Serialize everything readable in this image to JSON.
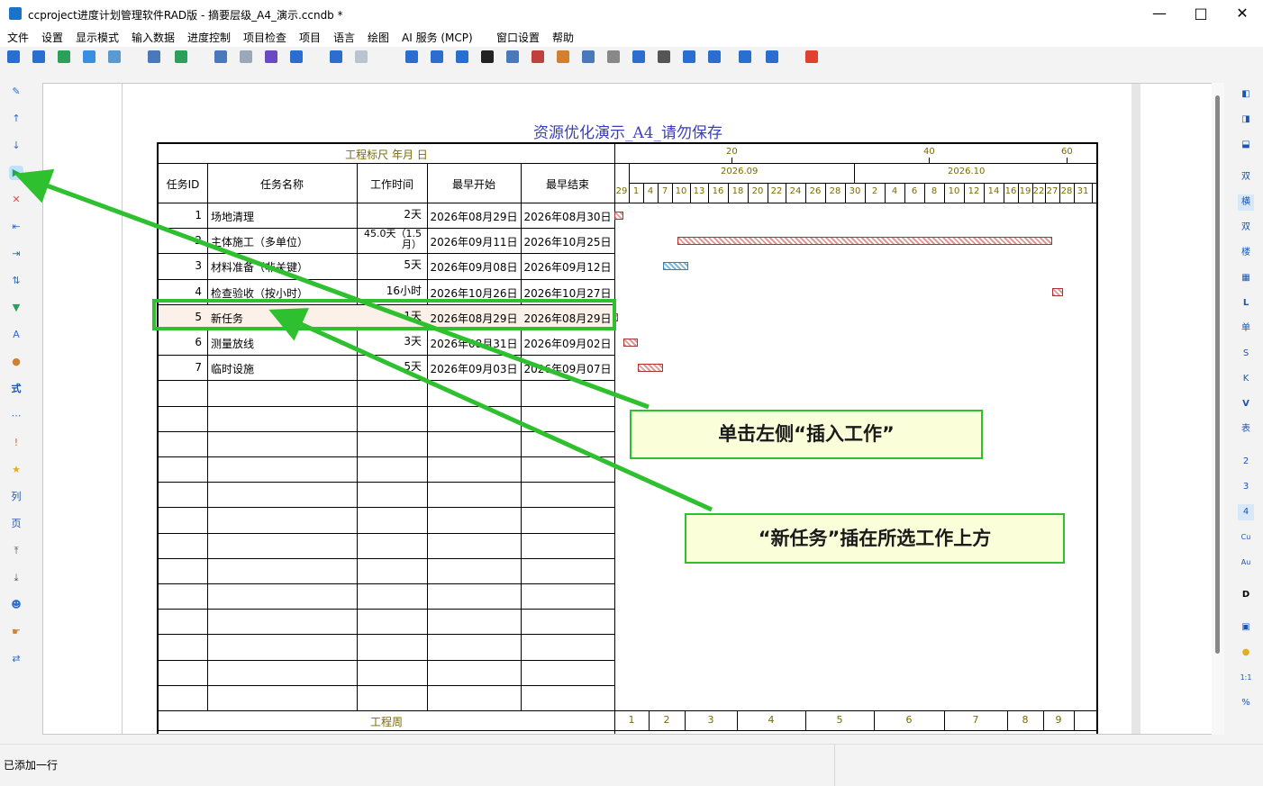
{
  "window": {
    "title": "ccproject进度计划管理软件RAD版 - 摘要层级_A4_演示.ccndb *",
    "minimize": "—",
    "maximize": "□",
    "close": "✕"
  },
  "menu": [
    "文件",
    "设置",
    "显示模式",
    "输入数据",
    "进度控制",
    "项目检查",
    "项目",
    "语言",
    "绘图",
    "AI 服务 (MCP)",
    "窗口设置",
    "帮助"
  ],
  "right_toolbar_labels": [
    "双",
    "横",
    "双",
    "楼",
    "L",
    "单",
    "S",
    "K",
    "V",
    "表",
    "2",
    "3",
    "4",
    "Cu",
    "Au",
    "D",
    "1:1",
    "%"
  ],
  "left_toolbar_labels": [
    "式",
    "列",
    "页"
  ],
  "sheet": {
    "title": "资源优化演示_A4_请勿保存",
    "ruler_label": "工程标尺 年月 日",
    "headers": {
      "id": "任务ID",
      "name": "任务名称",
      "duration": "工作时间",
      "start": "最早开始",
      "finish": "最早结束"
    },
    "scale_top": [
      "20",
      "40",
      "60"
    ],
    "months": [
      "2026.09",
      "2026.10"
    ],
    "days": [
      "29",
      "1",
      "4",
      "7",
      "10",
      "13",
      "16",
      "18",
      "20",
      "22",
      "24",
      "26",
      "28",
      "30",
      "2",
      "4",
      "6",
      "8",
      "10",
      "12",
      "14",
      "16",
      "19",
      "22",
      "27",
      "28",
      "31"
    ],
    "tasks": [
      {
        "id": "1",
        "name": "场地清理",
        "duration": "2天",
        "start": "2026年08月29日",
        "finish": "2026年08月30日"
      },
      {
        "id": "2",
        "name": "主体施工（多单位）",
        "duration": "45.0天（1.5月）",
        "start": "2026年09月11日",
        "finish": "2026年10月25日"
      },
      {
        "id": "3",
        "name": "材料准备（非关键）",
        "duration": "5天",
        "start": "2026年09月08日",
        "finish": "2026年09月12日"
      },
      {
        "id": "4",
        "name": "检查验收（按小时）",
        "duration": "16小时",
        "start": "2026年10月26日",
        "finish": "2026年10月27日"
      },
      {
        "id": "5",
        "name": "新任务",
        "duration": "1天",
        "start": "2026年08月29日",
        "finish": "2026年08月29日"
      },
      {
        "id": "6",
        "name": "测量放线",
        "duration": "3天",
        "start": "2026年08月31日",
        "finish": "2026年09月02日"
      },
      {
        "id": "7",
        "name": "临时设施",
        "duration": "5天",
        "start": "2026年09月03日",
        "finish": "2026年09月07日"
      }
    ],
    "footer_label": "工程周",
    "weeks": [
      "1",
      "2",
      "3",
      "4",
      "5",
      "6",
      "7",
      "8",
      "9"
    ]
  },
  "callouts": {
    "insert": "单击左侧“插入工作”",
    "above": "“新任务”插在所选工作上方"
  },
  "status": "已添加一行"
}
